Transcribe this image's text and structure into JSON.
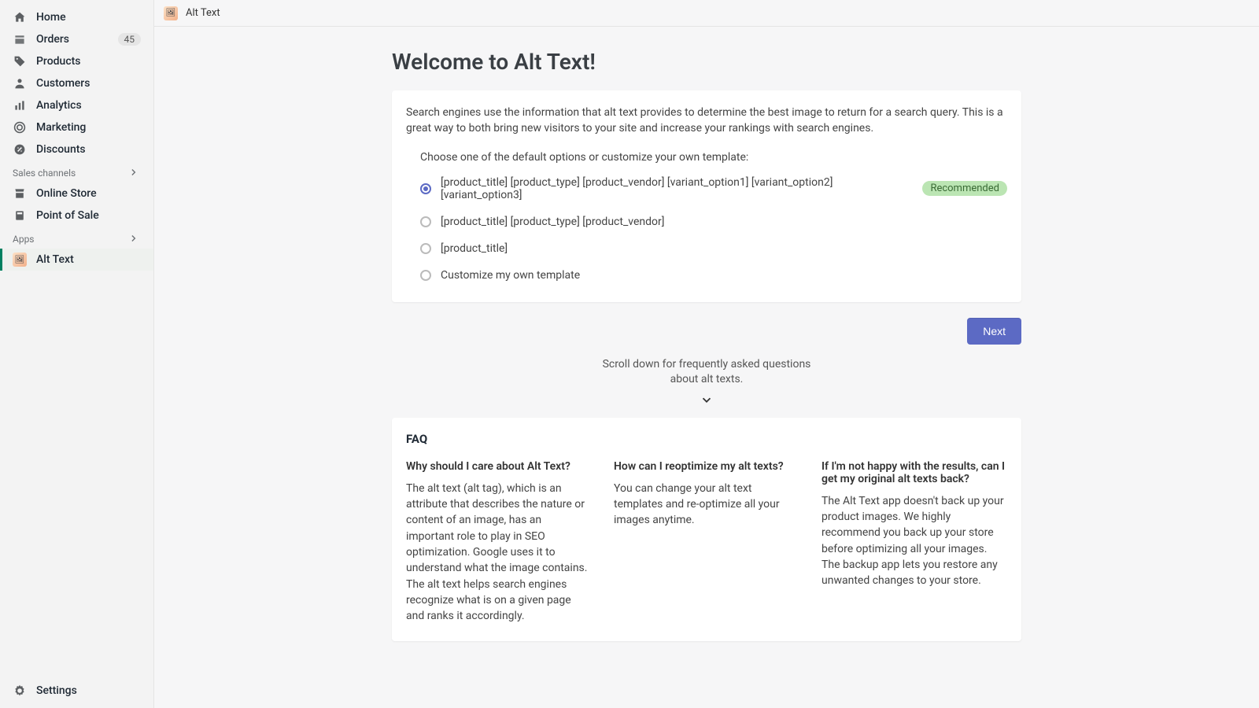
{
  "sidebar": {
    "main": [
      {
        "label": "Home"
      },
      {
        "label": "Orders",
        "badge": "45"
      },
      {
        "label": "Products"
      },
      {
        "label": "Customers"
      },
      {
        "label": "Analytics"
      },
      {
        "label": "Marketing"
      },
      {
        "label": "Discounts"
      }
    ],
    "sales_header": "Sales channels",
    "sales": [
      {
        "label": "Online Store"
      },
      {
        "label": "Point of Sale"
      }
    ],
    "apps_header": "Apps",
    "apps": [
      {
        "label": "Alt Text"
      }
    ],
    "settings_label": "Settings"
  },
  "titlebar": {
    "title": "Alt Text"
  },
  "page_title": "Welcome to Alt Text!",
  "intro": "Search engines use the information that alt text provides to determine the best image to return for a search query. This is a great way to both bring new visitors to your site and increase your rankings with search engines.",
  "choose_label": "Choose one of the default options or customize your own template:",
  "options": [
    {
      "label": "[product_title] [product_type] [product_vendor] [variant_option1] [variant_option2] [variant_option3]",
      "recommended": "Recommended",
      "selected": true
    },
    {
      "label": "[product_title] [product_type] [product_vendor]"
    },
    {
      "label": "[product_title]"
    },
    {
      "label": "Customize my own template"
    }
  ],
  "next_label": "Next",
  "scroll_hint": "Scroll down for frequently asked questions about alt texts.",
  "faq": {
    "title": "FAQ",
    "cols": [
      {
        "q": "Why should I care about Alt Text?",
        "a": "The alt text (alt tag), which is an attribute that describes the nature or content of an image, has an important role to play in SEO optimization. Google uses it to understand what the image contains. The alt text helps search engines recognize what is on a given page and ranks it accordingly."
      },
      {
        "q": "How can I reoptimize my alt texts?",
        "a": "You can change your alt text templates and re-optimize all your images anytime."
      },
      {
        "q": "If I'm not happy with the results, can I get my original alt texts back?",
        "a": "The Alt Text app doesn't back up your product images. We highly recommend you back up your store before optimizing all your images. The backup app lets you restore any unwanted changes to your store."
      }
    ]
  }
}
